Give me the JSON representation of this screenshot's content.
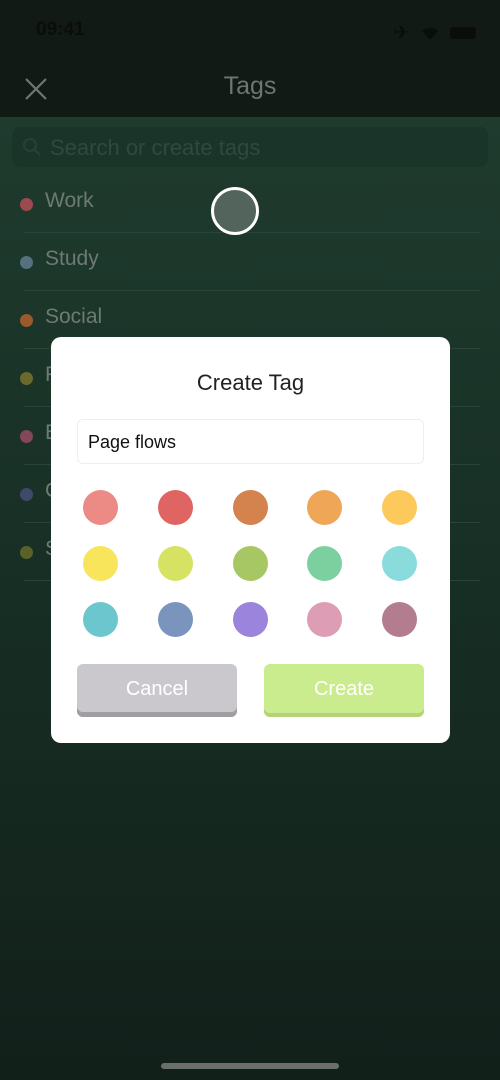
{
  "status": {
    "time": "09:41"
  },
  "nav": {
    "title": "Tags"
  },
  "search": {
    "placeholder": "Search or create tags"
  },
  "tags": [
    {
      "label": "Work",
      "color": "#9b4a50"
    },
    {
      "label": "Study",
      "color": "#55707e"
    },
    {
      "label": "Social",
      "color": "#9a5a2e"
    },
    {
      "label": "P",
      "color": "#6b6a2c"
    },
    {
      "label": "E",
      "color": "#82475a"
    },
    {
      "label": "C",
      "color": "#3f4a6a"
    },
    {
      "label": "S",
      "color": "#5a6229"
    }
  ],
  "dialog": {
    "title": "Create Tag",
    "name_value": "Page flows",
    "colors": [
      "#ec8a86",
      "#e06562",
      "#d4824e",
      "#efa657",
      "#fcc95a",
      "#f8e55c",
      "#d6e362",
      "#a7c765",
      "#7ccf9e",
      "#8adcdc",
      "#6cc6cd",
      "#7a94bd",
      "#9b85dc",
      "#dc9db5",
      "#b37d8f"
    ],
    "cancel_label": "Cancel",
    "create_label": "Create"
  }
}
